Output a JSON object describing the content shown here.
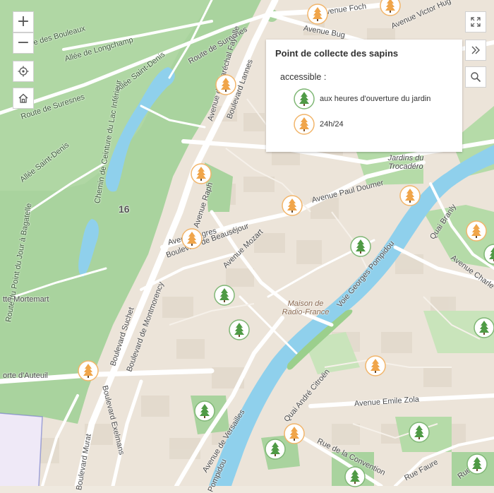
{
  "controls": {
    "zoom_in": "+",
    "zoom_out": "−"
  },
  "legend": {
    "title": "Point de collecte des sapins",
    "subtitle": "accessible :",
    "items": [
      {
        "label": "aux heures d'ouverture du jardin",
        "icon": "green-tree-icon",
        "color": "#4f9a45"
      },
      {
        "label": "24h/24",
        "icon": "orange-tree-icon",
        "color": "#f0a54a"
      }
    ]
  },
  "map_labels": {
    "avenue_foch": "Avenue Foch",
    "avenue_victor_hugo": "Avenue Victor Hug",
    "avenue_bugeaud": "Avenue Bug",
    "allee_longchamp": "Allée de Longchamp",
    "allee_boulots": "Allée des Bouleaux",
    "route_suresnes_top": "Route de Suresnes",
    "allee_saint_denis_top": "Allée Saint-Denis",
    "route_suresnes_left": "Route de Suresnes",
    "chemin_ceinture": "Chemin de Ceinture du Lac Inférieur",
    "allee_saint_denis_left": "Allée Saint-Denis",
    "route_point_jour": "Route du Point du Jour à Bagatelle",
    "marechal_fayolle": "Avenue du Maréchal Fayolle",
    "boulevard_lannes": "Boulevard Lannes",
    "avenue_raphael": "Avenue Raph",
    "avenue_ingres": "Avenue Ingres",
    "boulevard_beausejour": "Boulevard de Beauséjour",
    "avenue_mozart": "Avenue Mozart",
    "avenue_paul_doumer": "Avenue Paul Doumer",
    "jardins_trocadero": "Jardins du Trocadéro",
    "voie_pompidou": "Voie Georges Pompidou",
    "quai_branly": "Quai Branly",
    "avenue_charles": "Avenue Charle",
    "maison_radio_france": "Maison de Radio-France",
    "boulevard_suchet": "Boulevard Suchet",
    "boulevard_montmorency": "Boulevard de Montmorency",
    "butte_mortemart": "tte Mortemart",
    "porte_auteuil": "orte d'Auteuil",
    "boulevard_exelmans": "Boulevard Exelmans",
    "boulevard_murat": "Boulevard Murat",
    "avenue_versailles": "Avenue de Versailles",
    "quai_andre_citroen": "Quai André Citroën",
    "avenue_emile_zola": "Avenue Emile Zola",
    "rue_convention": "Rue de la Convention",
    "rue_faure": "Rue Faure",
    "voie_pompidou_bottom": "Pompidou",
    "rue_nivert": "Rue Nive",
    "district_16": "16"
  },
  "markers": [
    {
      "kind": "orange"
    },
    {
      "kind": "orange"
    },
    {
      "kind": "orange"
    },
    {
      "kind": "orange"
    },
    {
      "kind": "orange"
    },
    {
      "kind": "orange"
    },
    {
      "kind": "orange"
    },
    {
      "kind": "orange"
    },
    {
      "kind": "orange"
    },
    {
      "kind": "orange"
    },
    {
      "kind": "orange"
    },
    {
      "kind": "green"
    },
    {
      "kind": "green"
    },
    {
      "kind": "green"
    },
    {
      "kind": "green"
    },
    {
      "kind": "green"
    },
    {
      "kind": "green"
    },
    {
      "kind": "green"
    },
    {
      "kind": "green"
    },
    {
      "kind": "green"
    },
    {
      "kind": "green"
    }
  ],
  "colors": {
    "park": "#a9d39e",
    "park_light": "#c3e1b6",
    "water": "#8fd0ec",
    "urban": "#e9e1d6",
    "road": "#ffffff",
    "green_marker": "#4f9a45",
    "orange_marker": "#f0a54a"
  }
}
